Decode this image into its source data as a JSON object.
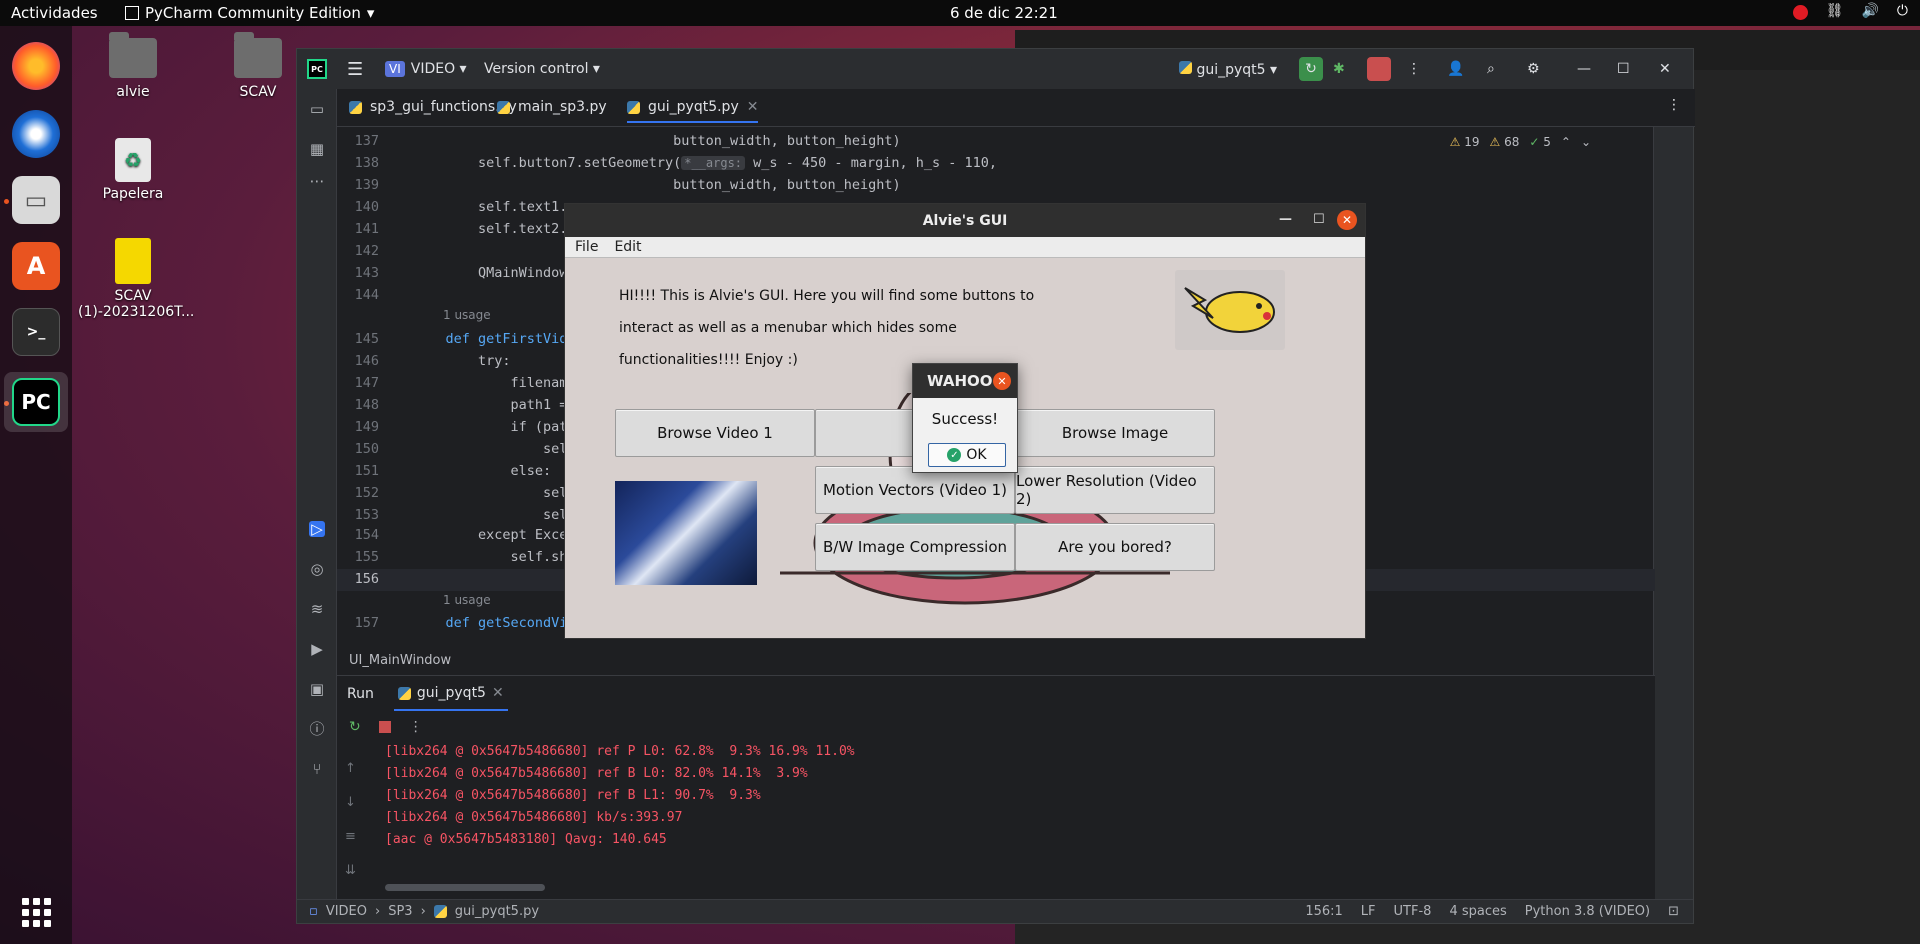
{
  "topbar": {
    "activities": "Actividades",
    "app_name": "PyCharm Community Edition",
    "clock": "6 de dic  22:21"
  },
  "desktop": {
    "icons": [
      {
        "label": "alvie"
      },
      {
        "label": "SCAV"
      },
      {
        "label": "Papelera"
      },
      {
        "label": "SCAV (1)-20231206T..."
      }
    ]
  },
  "pycharm": {
    "project_badge": "VI",
    "project_name": "VIDEO",
    "vcs": "Version control",
    "run_config": "gui_pyqt5",
    "tabs": [
      {
        "label": "sp3_gui_functions.py"
      },
      {
        "label": "main_sp3.py"
      },
      {
        "label": "gui_pyqt5.py"
      }
    ],
    "inspections": {
      "warnings": "19",
      "weak": "68",
      "ok": "5"
    },
    "editor_lines": [
      {
        "num": "137",
        "text": "                                button_width, button_height)"
      },
      {
        "num": "138",
        "text": "        self.button7.setGeometry("
      },
      {
        "num": "139",
        "text": "                                button_width, button_height)"
      },
      {
        "num": "140",
        "text": "        self.text1."
      },
      {
        "num": "141",
        "text": "        self.text2."
      },
      {
        "num": "142",
        "text": ""
      },
      {
        "num": "143",
        "text": "        QMainWindow"
      },
      {
        "num": "144",
        "text": ""
      },
      {
        "num": "145",
        "text": "    def getFirstVid"
      },
      {
        "num": "146",
        "text": "        try:"
      },
      {
        "num": "147",
        "text": "            filenam"
      },
      {
        "num": "148",
        "text": "            path1 ="
      },
      {
        "num": "149",
        "text": "            if (pat"
      },
      {
        "num": "150",
        "text": "                sel"
      },
      {
        "num": "151",
        "text": "            else:"
      },
      {
        "num": "152",
        "text": "                sel"
      },
      {
        "num": "153",
        "text": "                sel"
      },
      {
        "num": "154",
        "text": "        except Exce"
      },
      {
        "num": "155",
        "text": "            self.sh"
      },
      {
        "num": "156",
        "text": ""
      },
      {
        "num": "157",
        "text": "    def getSecondVi"
      }
    ],
    "line138_hint": "*__args:",
    "line138_tail": "w_s - 450 - margin, h_s - 110,",
    "usage_label": "1 usage",
    "code_breadcrumb": "UI_MainWindow",
    "run": {
      "tab_run": "Run",
      "tab_config": "gui_pyqt5",
      "console": [
        "[libx264 @ 0x5647b5486680] ref P L0: 62.8%  9.3% 16.9% 11.0%",
        "[libx264 @ 0x5647b5486680] ref B L0: 82.0% 14.1%  3.9%",
        "[libx264 @ 0x5647b5486680] ref B L1: 90.7%  9.3%",
        "[libx264 @ 0x5647b5486680] kb/s:393.97",
        "[aac @ 0x5647b5483180] Qavg: 140.645"
      ]
    },
    "status": {
      "path": [
        "VIDEO",
        "SP3",
        "gui_pyqt5.py"
      ],
      "position": "156:1",
      "line_sep": "LF",
      "encoding": "UTF-8",
      "indent": "4 spaces",
      "interpreter": "Python 3.8 (VIDEO)"
    }
  },
  "alvie_gui": {
    "title": "Alvie's GUI",
    "menu": [
      "File",
      "Edit"
    ],
    "intro": "HI!!!! This is Alvie's GUI. Here you will find some buttons to interact as well as a menubar which hides some functionalities!!!! Enjoy :)",
    "buttons": {
      "browse_video_1": "Browse Video 1",
      "browse_image": "Browse Image",
      "motion_vectors": "Motion Vectors (Video 1)",
      "lower_resolution": "Lower Resolution (Video 2)",
      "bw_compression": "B/W Image Compression",
      "bored": "Are you bored?"
    }
  },
  "dialog": {
    "title": "WAHOO",
    "message": "Success!",
    "ok": "OK"
  },
  "colors": {
    "accent_ubuntu": "#e95420",
    "pycharm_bg": "#1e1f22",
    "console_error": "#f75464"
  }
}
